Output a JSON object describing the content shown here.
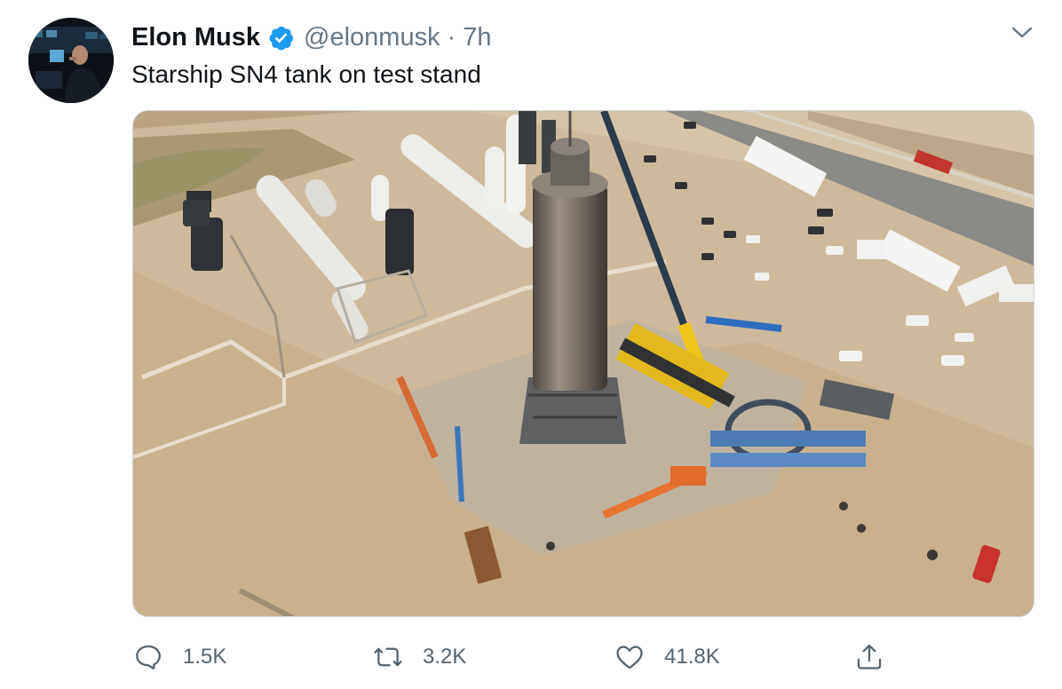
{
  "tweet": {
    "author_name": "Elon Musk",
    "handle": "@elonmusk",
    "separator": "·",
    "time_ago": "7h",
    "text": "Starship SN4 tank on test stand",
    "verified": true
  },
  "actions": {
    "reply_count": "1.5K",
    "retweet_count": "3.2K",
    "like_count": "41.8K"
  },
  "icons": {
    "verified": "verified-badge-icon",
    "menu": "chevron-down-icon",
    "reply": "reply-icon",
    "retweet": "retweet-icon",
    "like": "heart-icon",
    "share": "share-icon"
  },
  "colors": {
    "verified_blue": "#1d9bf0",
    "text_primary": "#0f1419",
    "text_secondary": "#657786",
    "action_grey": "#536471"
  }
}
